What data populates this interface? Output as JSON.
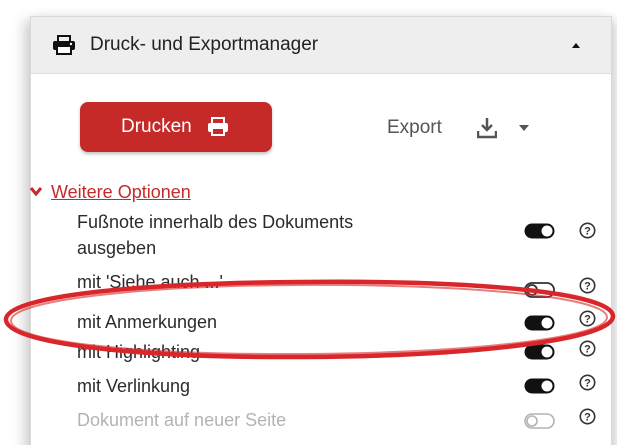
{
  "panel": {
    "title": "Druck- und Exportmanager",
    "header_icon": "printer-icon",
    "collapse_icon": "caret-up-icon"
  },
  "actions": {
    "print_label": "Drucken",
    "print_icon": "printer-icon",
    "export_label": "Export",
    "export_icon": "download-icon",
    "export_dropdown_icon": "caret-down-icon"
  },
  "more_options": {
    "label": "Weitere Optionen",
    "icon": "chevron-down-icon"
  },
  "options": [
    {
      "label_line1": "Fußnote innerhalb des Dokuments",
      "label_line2": "ausgeben",
      "enabled": true,
      "disabled": false
    },
    {
      "label": "mit 'Siehe auch ...'",
      "enabled": false,
      "disabled": false
    },
    {
      "label": "mit Anmerkungen",
      "enabled": true,
      "disabled": false
    },
    {
      "label": "mit Highlighting",
      "enabled": true,
      "disabled": false
    },
    {
      "label": "mit Verlinkung",
      "enabled": true,
      "disabled": false
    },
    {
      "label": "Dokument auf neuer Seite",
      "enabled": false,
      "disabled": true
    }
  ],
  "help_icon": "question-circle-icon",
  "colors": {
    "accent": "#c62a28",
    "header_bg": "#eeeeee",
    "toggle_on": "#111111",
    "toggle_off_border": "#444444",
    "disabled": "#b3b3b3",
    "annotation": "#d8262a"
  },
  "annotation": "red-ellipse-highlight"
}
